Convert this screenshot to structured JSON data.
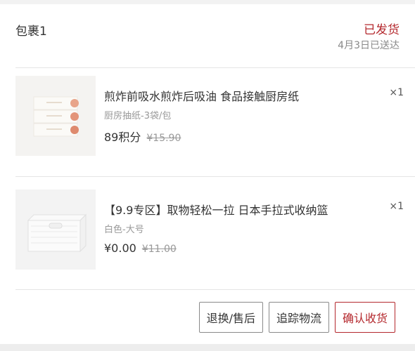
{
  "package": {
    "title": "包裹1",
    "status": "已发货",
    "delivery_note": "4月3日已送达"
  },
  "products": [
    {
      "name": "煎炸前吸水煎炸后吸油 食品接触厨房纸",
      "spec": "厨房抽纸-3袋/包",
      "price": "89积分",
      "original_price": "¥15.90",
      "quantity": "×1",
      "thumbnail_icon": "kitchen-paper-thumbnail"
    },
    {
      "name": "【9.9专区】取物轻松一拉 日本手拉式收纳篮",
      "spec": "白色-大号",
      "price": "¥0.00",
      "original_price": "¥11.00",
      "quantity": "×1",
      "thumbnail_icon": "storage-basket-thumbnail"
    }
  ],
  "actions": {
    "return_label": "退换/售后",
    "track_label": "追踪物流",
    "confirm_label": "确认收货"
  },
  "colors": {
    "accent": "#b4282d",
    "secondary_text": "#999999",
    "divider": "#e5e5e5"
  }
}
